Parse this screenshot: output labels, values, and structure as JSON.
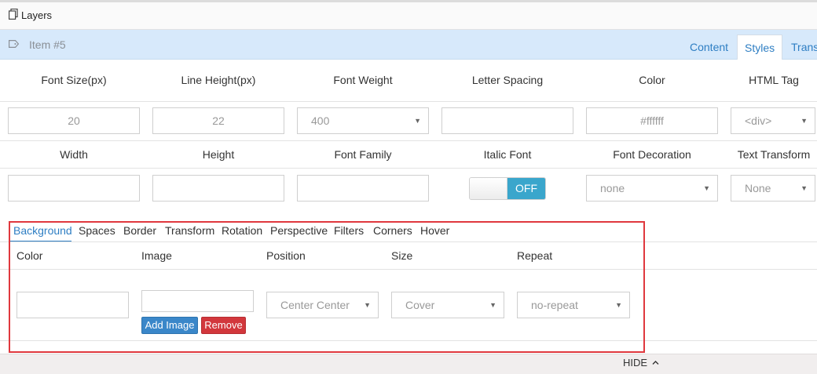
{
  "layers": {
    "label": "Layers",
    "icon": "copy-icon"
  },
  "item": {
    "label": "Item #5",
    "icon": "tag-icon"
  },
  "top_tabs": [
    {
      "label": "Content",
      "active": false
    },
    {
      "label": "Styles",
      "active": true
    },
    {
      "label": "Trans",
      "active": false
    }
  ],
  "row1": {
    "labels": [
      "Font Size(px)",
      "Line Height(px)",
      "Font Weight",
      "Letter Spacing",
      "Color",
      "HTML Tag"
    ],
    "font_size": "20",
    "line_height": "22",
    "font_weight": "400",
    "letter_spacing": "",
    "color": "#ffffff",
    "html_tag": "<div>"
  },
  "row2": {
    "labels": [
      "Width",
      "Height",
      "Font Family",
      "Italic Font",
      "Font Decoration",
      "Text Transform"
    ],
    "width": "",
    "height": "",
    "font_family": "",
    "italic_toggle": "OFF",
    "font_decoration": "none",
    "text_transform": "None"
  },
  "sub_tabs": [
    "Background",
    "Spaces",
    "Border",
    "Transform",
    "Rotation",
    "Perspective",
    "Filters",
    "Corners",
    "Hover"
  ],
  "background": {
    "labels": [
      "Color",
      "Image",
      "Position",
      "Size",
      "Repeat"
    ],
    "color": "",
    "image": "",
    "add_image": "Add Image",
    "remove": "Remove",
    "position": "Center Center",
    "size": "Cover",
    "repeat": "no-repeat"
  },
  "hide": {
    "label": "HIDE",
    "icon": "chevron-up-icon"
  },
  "colors": {
    "accent": "#2e7ec3",
    "highlight": "#e0383e",
    "toggle": "#3aa6cc",
    "item_bar": "#d7e9fb"
  }
}
